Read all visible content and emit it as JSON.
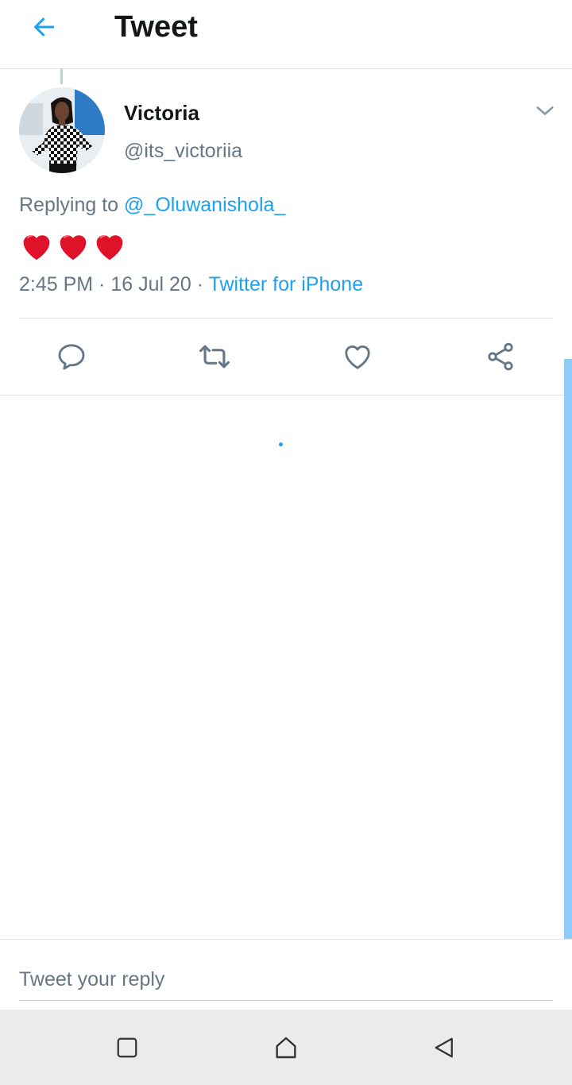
{
  "header": {
    "title": "Tweet"
  },
  "tweet": {
    "author_name": "Victoria",
    "author_handle": "@its_victoriia",
    "replying_prefix": "Replying to",
    "replying_to": "@_Oluwanishola_",
    "text": "❤️❤️❤️",
    "time": "2:45 PM · 16 Jul 20 · ",
    "source": "Twitter for iPhone"
  },
  "actions": [
    "reply-icon",
    "retweet-icon",
    "like-icon",
    "share-icon"
  ],
  "reply_bar": {
    "placeholder": "Tweet your reply"
  },
  "navbar": [
    "recents-square-icon",
    "home-icon",
    "back-triangle-icon"
  ],
  "colors": {
    "accent": "#1da1f2",
    "secondary_text": "#657786",
    "heart": "#e0122a"
  }
}
